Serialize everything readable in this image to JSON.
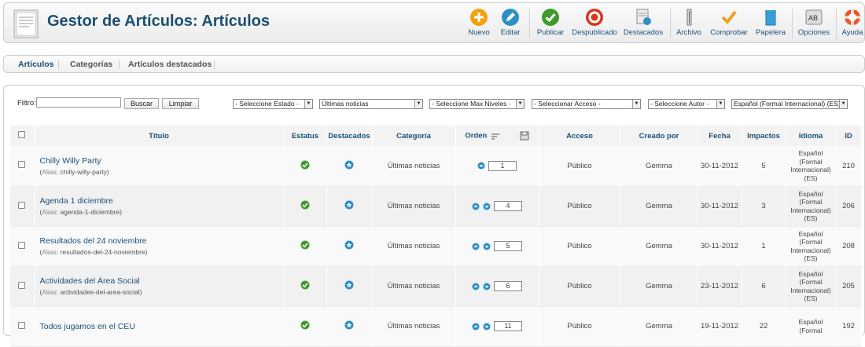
{
  "header": {
    "title": "Gestor de Artículos: Artículos",
    "toolbar": [
      {
        "label": "Nuevo",
        "icon": "plus-icon"
      },
      {
        "label": "Editar",
        "icon": "pencil-icon"
      },
      {
        "label": "Publicar",
        "icon": "check-icon"
      },
      {
        "label": "Despublicado",
        "icon": "unpublish-icon"
      },
      {
        "label": "Destacados",
        "icon": "featured-icon"
      },
      {
        "label": "Archivo",
        "icon": "archive-icon"
      },
      {
        "label": "Comprobar",
        "icon": "checkin-icon"
      },
      {
        "label": "Papelera",
        "icon": "trash-icon"
      },
      {
        "label": "Opciones",
        "icon": "options-icon"
      },
      {
        "label": "Ayuda",
        "icon": "help-icon"
      }
    ]
  },
  "subnav": {
    "items": [
      "Artículos",
      "Categorías",
      "Artículos destacados"
    ]
  },
  "filters": {
    "label": "Filtro:",
    "search_value": "",
    "search_button": "Buscar",
    "clear_button": "Limpiar",
    "state": "- Seleccione Estado -",
    "category": "Últimas noticias",
    "levels": "- Seleccione Max Niveles -",
    "access": "- Seleccionar Acceso -",
    "author": "- Seleccione Autor -",
    "language": "Español (Formal Internacional) (ES)"
  },
  "table": {
    "headers": {
      "title": "Título",
      "status": "Estatus",
      "featured": "Destacados",
      "category": "Categoría",
      "order": "Orden",
      "access": "Acceso",
      "created_by": "Creado por",
      "date": "Fecha",
      "hits": "Impactos",
      "language": "Idioma",
      "id": "ID"
    },
    "alias_label": "Alias",
    "rows": [
      {
        "title": "Chilly Willy Party",
        "alias": "chilly-willy-party",
        "category": "Últimas noticias",
        "order": "1",
        "access": "Público",
        "author": "Gemma",
        "date": "30-11-2012",
        "hits": "5",
        "lang": [
          "Español",
          "(Formal",
          "Internacional)",
          "(ES)"
        ],
        "id": "210"
      },
      {
        "title": "Agenda 1 diciembre",
        "alias": "agenda-1-diciembre",
        "category": "Últimas noticias",
        "order": "4",
        "access": "Público",
        "author": "Gemma",
        "date": "30-11-2012",
        "hits": "3",
        "lang": [
          "Español",
          "(Formal",
          "Internacional)",
          "(ES)"
        ],
        "id": "206"
      },
      {
        "title": "Resultados del 24 noviembre",
        "alias": "resultados-del-24-noviembre",
        "category": "Últimas noticias",
        "order": "5",
        "access": "Público",
        "author": "Gemma",
        "date": "30-11-2012",
        "hits": "1",
        "lang": [
          "Español",
          "(Formal",
          "Internacional)",
          "(ES)"
        ],
        "id": "208"
      },
      {
        "title": "Actividades del Área Social",
        "alias": "actividades-del-area-social",
        "category": "Últimas noticias",
        "order": "6",
        "access": "Público",
        "author": "Gemma",
        "date": "23-11-2012",
        "hits": "6",
        "lang": [
          "Español",
          "(Formal",
          "Internacional)",
          "(ES)"
        ],
        "id": "205"
      },
      {
        "title": "Todos jugamos en el CEU",
        "alias": "",
        "category": "Últimas noticias",
        "order": "11",
        "access": "Público",
        "author": "Gemma",
        "date": "19-11-2012",
        "hits": "22",
        "lang": [
          "Español",
          "(Formal",
          "",
          ""
        ],
        "id": "192"
      }
    ]
  }
}
